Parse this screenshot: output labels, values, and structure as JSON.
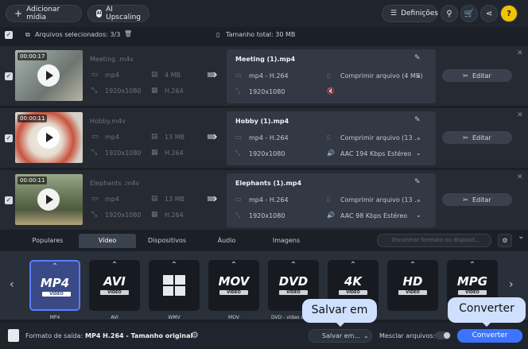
{
  "topbar": {
    "add_media": "Adicionar mídia",
    "ai_upscaling": "AI Upscaling",
    "settings": "Definições"
  },
  "selection": {
    "selected_files": "Arquivos selecionados: 3/3",
    "total_size": "Tamanho total: 30 MB"
  },
  "files": [
    {
      "duration": "00:00:17",
      "source_name": "Meeting .m4v",
      "src_format": "mp4",
      "src_size": "4 MB",
      "src_res": "1920x1080",
      "src_codec": "H.264",
      "out_name": "Meeting  (1).mp4",
      "out_format": "mp4 - H.264",
      "out_compress": "Comprimir arquivo (4 MB)",
      "out_res": "1920x1080",
      "out_audio": "",
      "edit": "Editar"
    },
    {
      "duration": "00:00:11",
      "source_name": "Hobby.m4v",
      "src_format": "mp4",
      "src_size": "13 MB",
      "src_res": "1920x1080",
      "src_codec": "H.264",
      "out_name": "Hobby (1).mp4",
      "out_format": "mp4 - H.264",
      "out_compress": "Comprimir arquivo (13 ...",
      "out_res": "1920x1080",
      "out_audio": "AAC 194 Kbps Estéreo",
      "edit": "Editar"
    },
    {
      "duration": "00:00:11",
      "source_name": "Elephants .m4v",
      "src_format": "mp4",
      "src_size": "13 MB",
      "src_res": "1920x1080",
      "src_codec": "H.264",
      "out_name": "Elephants  (1).mp4",
      "out_format": "mp4 - H.264",
      "out_compress": "Comprimir arquivo (13 ...",
      "out_res": "1920x1080",
      "out_audio": "AAC 98 Kbps Estéreo",
      "edit": "Editar"
    }
  ],
  "tabs": [
    "Populares",
    "Vídeo",
    "Dispositivos",
    "Áudio",
    "Imagens"
  ],
  "active_tab": "Vídeo",
  "search_placeholder": "Encontrar formato ou disposit...",
  "formats": [
    {
      "label": "MP4",
      "sub": "VIDEO",
      "name": "MP4"
    },
    {
      "label": "AVI",
      "sub": "VIDEO",
      "name": "AVI"
    },
    {
      "label": "WMV",
      "sub": "",
      "name": "WMV"
    },
    {
      "label": "MOV",
      "sub": "VIDEO",
      "name": "MOV"
    },
    {
      "label": "DVD",
      "sub": "VIDEO",
      "name": "DVD - vídeo com..."
    },
    {
      "label": "4K",
      "sub": "VIDEO",
      "name": "4K"
    },
    {
      "label": "HD",
      "sub": "VIDEO",
      "name": "HD/Full HD"
    },
    {
      "label": "MPG",
      "sub": "VIDEO",
      "name": "MPG"
    }
  ],
  "bottom": {
    "output_format_label": "Formato de saída:",
    "output_format_value": "MP4 H.264 - Tamanho original",
    "save_to": "Salvar em...",
    "merge_files": "Mesclar arquivos:",
    "convert": "Converter",
    "callout_save": "Salvar em",
    "callout_convert": "Converter"
  },
  "colors": {
    "accent": "#3d74ff",
    "selected_format": "#3a4a87"
  }
}
